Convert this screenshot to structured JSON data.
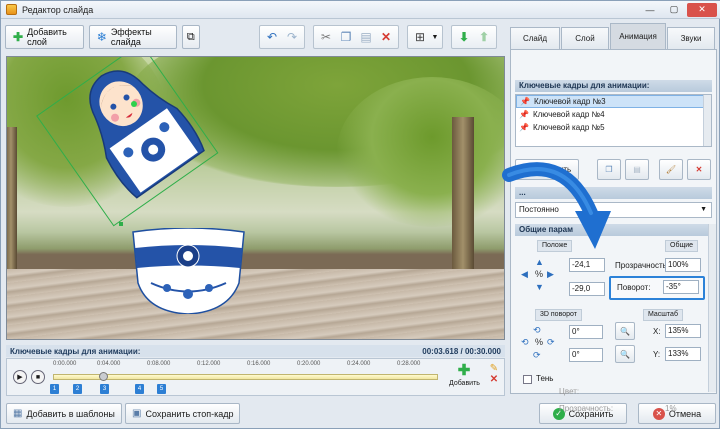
{
  "window": {
    "title": "Редактор слайда"
  },
  "toolbar": {
    "add_layer": "Добавить слой",
    "slide_effects": "Эффекты слайда"
  },
  "timeline": {
    "header": "Ключевые кадры для анимации:",
    "time": "00:03.618 / 00:30.000",
    "ticks": [
      "0:00.000",
      "0:04.000",
      "0:08.000",
      "0:12.000",
      "0:16.000",
      "0:20.000",
      "0:24.000",
      "0:28.000"
    ],
    "markers": [
      "1",
      "2",
      "3",
      "4",
      "5"
    ],
    "add_label": "Добавить"
  },
  "bottom": {
    "add_to_templates": "Добавить в шаблоны",
    "save_frame": "Сохранить стоп-кадр",
    "save": "Сохранить",
    "cancel": "Отмена"
  },
  "panel": {
    "tabs": [
      "Слайд",
      "Слой",
      "Анимация",
      "Звуки"
    ],
    "active_tab": "Анимация",
    "keyframes_header": "Ключевые кадры для анимации:",
    "keyframes": [
      "Ключевой кадр №3",
      "Ключевой кадр №4",
      "Ключевой кадр №5"
    ],
    "add_button": "Добавить",
    "motion_header": "...",
    "motion_value": "Постоянно",
    "general_header": "Общие парам",
    "position_head": "Положе",
    "general_head": "Общие",
    "pos_x": "-24,1",
    "pos_y": "-29,0",
    "opacity_label": "Прозрачность:",
    "opacity_value": "100%",
    "rotation_label": "Поворот:",
    "rotation_value": "-35°",
    "rotation3d_head": "3D поворот",
    "scale_head": "Масштаб",
    "rot3d_x": "0°",
    "rot3d_y": "0°",
    "scale_x_label": "X:",
    "scale_x": "135%",
    "scale_y_label": "Y:",
    "scale_y": "133%",
    "shadow_label": "Тень",
    "color_label": "Цвет:",
    "shadow_opacity_label": "Прозрачность:",
    "shadow_opacity": "1%"
  },
  "colors": {
    "accent": "#2c82d8",
    "header_bg": "#b8cadc",
    "save_green": "#2fae4a",
    "cancel_red": "#d9524b"
  }
}
